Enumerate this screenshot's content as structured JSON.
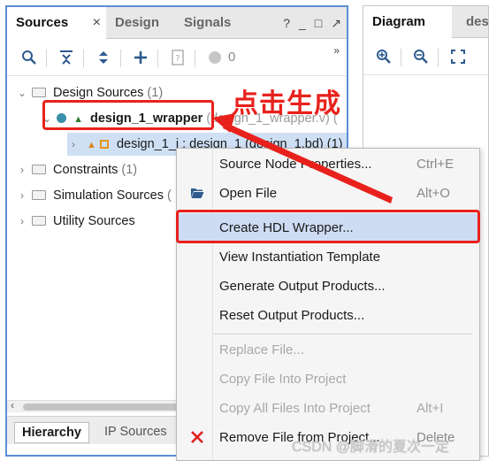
{
  "left_panel": {
    "tabs": [
      {
        "label": "Sources",
        "active": true,
        "close": "×"
      },
      {
        "label": "Design",
        "active": false
      },
      {
        "label": "Signals",
        "active": false
      }
    ],
    "controls": [
      "?",
      "_",
      "□",
      "↗"
    ],
    "toolbar": {
      "count": "0",
      "more": "»"
    },
    "tree": {
      "design_sources": {
        "label": "Design Sources",
        "count": "(1)"
      },
      "wrapper": {
        "label": "design_1_wrapper",
        "file": "(design_1_wrapper.v) ("
      },
      "instance": {
        "label": "design_1_i : design_1 (design_1.bd) (1)"
      },
      "constraints": {
        "label": "Constraints",
        "count": "(1)"
      },
      "simulation": {
        "label": "Simulation Sources",
        "count": "("
      },
      "utility": {
        "label": "Utility Sources"
      }
    },
    "bottom_tabs": [
      "Hierarchy",
      "IP Sources"
    ]
  },
  "right_panel": {
    "tabs": [
      {
        "label": "Diagram"
      },
      {
        "label": "des"
      }
    ]
  },
  "context_menu": {
    "items": [
      {
        "label": "Source Node Properties...",
        "shortcut": "Ctrl+E",
        "enabled": true
      },
      {
        "label": "Open File",
        "shortcut": "Alt+O",
        "enabled": true,
        "icon": "folder-open-icon"
      },
      {
        "label": "Create HDL Wrapper...",
        "shortcut": "",
        "enabled": true,
        "highlighted": true
      },
      {
        "label": "View Instantiation Template",
        "shortcut": "",
        "enabled": true
      },
      {
        "label": "Generate Output Products...",
        "shortcut": "",
        "enabled": true
      },
      {
        "label": "Reset Output Products...",
        "shortcut": "",
        "enabled": true
      },
      {
        "label": "Replace File...",
        "shortcut": "",
        "enabled": false
      },
      {
        "label": "Copy File Into Project",
        "shortcut": "",
        "enabled": false
      },
      {
        "label": "Copy All Files Into Project",
        "shortcut": "Alt+I",
        "enabled": false
      },
      {
        "label": "Remove File from Project...",
        "shortcut": "Delete",
        "enabled": true,
        "icon": "remove-x-icon"
      }
    ]
  },
  "annotation": {
    "text": "点击生成",
    "color": "#e8211c"
  },
  "watermark": "CSDN @脚滑的夏次一定",
  "colors": {
    "panel_border": "#5b8ed6",
    "highlight": "#cddcf3",
    "selection": "#cfe0f5",
    "annotation_red": "#e8211c"
  }
}
